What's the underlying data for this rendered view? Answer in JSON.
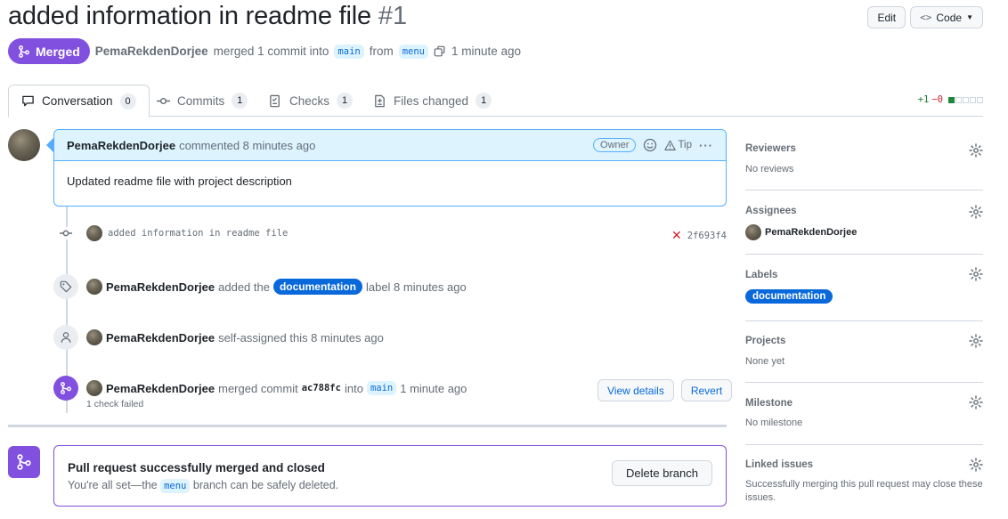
{
  "pr": {
    "title": "added information in readme file",
    "number": "#1",
    "state": "Merged",
    "author": "PemaRekdenDorjee",
    "merged_text": "merged 1 commit into",
    "base_branch": "main",
    "from_text": "from",
    "head_branch": "menu",
    "time": "1 minute ago"
  },
  "header_actions": {
    "edit": "Edit",
    "code": "Code"
  },
  "tabs": [
    {
      "label": "Conversation",
      "count": "0"
    },
    {
      "label": "Commits",
      "count": "1"
    },
    {
      "label": "Checks",
      "count": "1"
    },
    {
      "label": "Files changed",
      "count": "1"
    }
  ],
  "diffstat": {
    "additions": "+1",
    "deletions": "−0"
  },
  "comment": {
    "author": "PemaRekdenDorjee",
    "action": "commented 8 minutes ago",
    "badge": "Owner",
    "tip": "Tip",
    "more": "···",
    "body": "Updated readme file with project description"
  },
  "timeline": {
    "commit": {
      "message": "added information in readme file",
      "sha": "2f693f4"
    },
    "label_event": {
      "author": "PemaRekdenDorjee",
      "pre": "added the",
      "label": "documentation",
      "post": "label 8 minutes ago"
    },
    "assign_event": {
      "author": "PemaRekdenDorjee",
      "text": "self-assigned this 8 minutes ago"
    },
    "merge_event": {
      "author": "PemaRekdenDorjee",
      "pre": "merged commit",
      "sha": "ac788fc",
      "mid": "into",
      "branch": "main",
      "time": "1 minute ago",
      "check": "1 check failed",
      "view_details": "View details",
      "revert": "Revert"
    }
  },
  "merge_box": {
    "title": "Pull request successfully merged and closed",
    "sub_pre": "You're all set—the",
    "branch": "menu",
    "sub_post": "branch can be safely deleted.",
    "delete_button": "Delete branch"
  },
  "sidebar": {
    "reviewers": {
      "heading": "Reviewers",
      "value": "No reviews"
    },
    "assignees": {
      "heading": "Assignees",
      "user": "PemaRekdenDorjee"
    },
    "labels": {
      "heading": "Labels",
      "label": "documentation"
    },
    "projects": {
      "heading": "Projects",
      "value": "None yet"
    },
    "milestone": {
      "heading": "Milestone",
      "value": "No milestone"
    },
    "linked_issues": {
      "heading": "Linked issues",
      "value": "Successfully merging this pull request may close these issues."
    }
  },
  "colors": {
    "merged": "#8250df",
    "accent": "#0969da",
    "comment_border": "#54aeff",
    "comment_header": "#ddf4ff",
    "fail": "#cf222e",
    "add": "#1a7f37"
  }
}
